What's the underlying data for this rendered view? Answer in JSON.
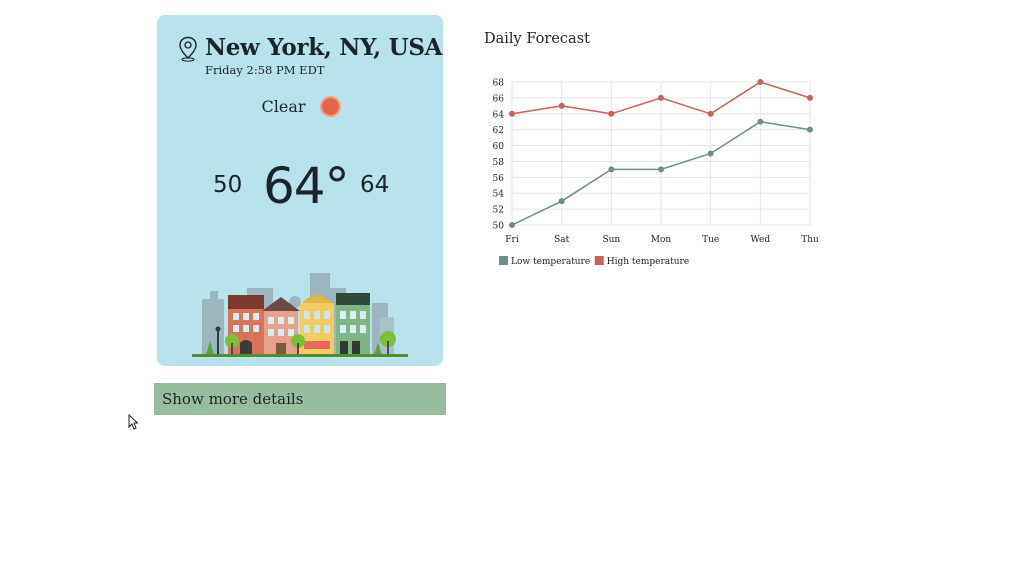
{
  "weather": {
    "location": "New York, NY, USA",
    "datetime": "Friday 2:58 PM EDT",
    "condition": "Clear",
    "temp_low": "50",
    "temp_current": "64°",
    "temp_high": "64"
  },
  "details_button_label": "Show more details",
  "forecast": {
    "title": "Daily Forecast"
  },
  "chart_data": {
    "type": "line",
    "title": "Daily Forecast",
    "categories": [
      "Fri",
      "Sat",
      "Sun",
      "Mon",
      "Tue",
      "Wed",
      "Thu"
    ],
    "series": [
      {
        "name": "Low temperature",
        "values": [
          50,
          53,
          57,
          57,
          59,
          63,
          62
        ],
        "color": "#6b8f8e"
      },
      {
        "name": "High temperature",
        "values": [
          64,
          65,
          64,
          66,
          64,
          68,
          66
        ],
        "color": "#c9625b"
      }
    ],
    "yticks": [
      50,
      52,
      54,
      56,
      58,
      60,
      62,
      64,
      66,
      68
    ],
    "ylim": [
      50,
      68
    ],
    "grid": true,
    "legend": "bottom-left"
  },
  "icons": {
    "location": "map-pin-icon",
    "condition": "sun-icon",
    "cursor": "mouse-cursor-icon"
  },
  "colors": {
    "card_background": "#b8e2ec",
    "button_background": "#98bd9e",
    "sun": "#e5654a"
  }
}
